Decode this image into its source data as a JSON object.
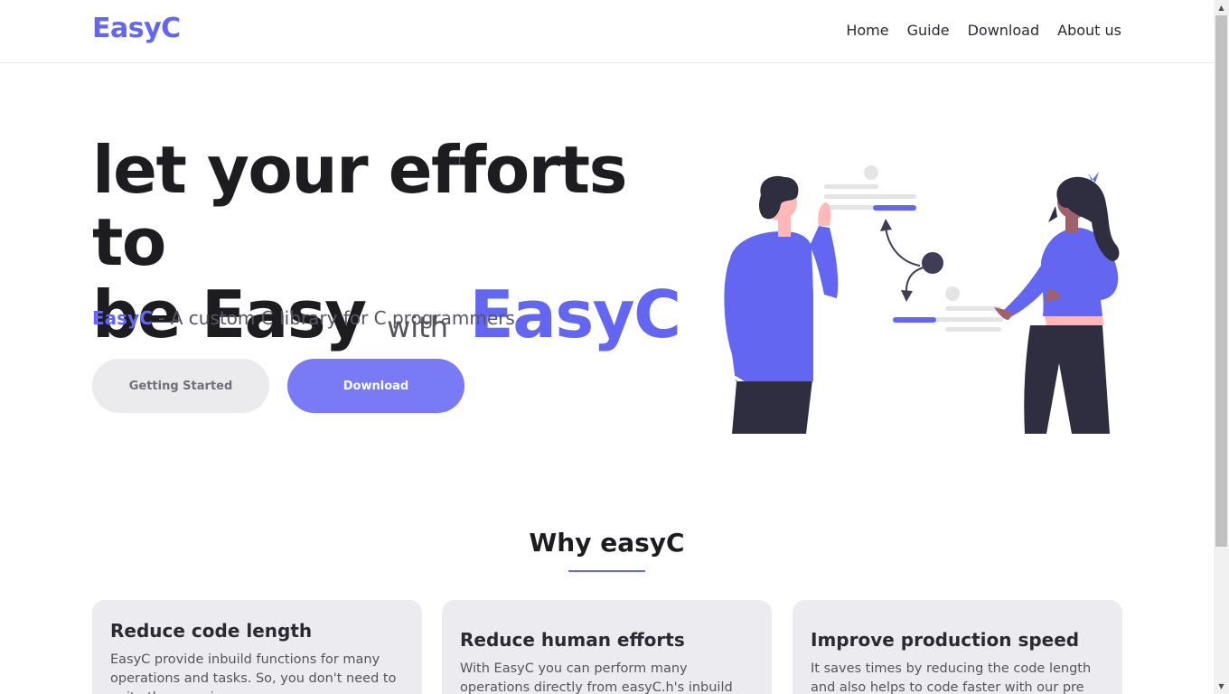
{
  "header": {
    "logo": "EasyC",
    "nav": [
      "Home",
      "Guide",
      "Download",
      "About us"
    ]
  },
  "hero": {
    "title_line1": "let your efforts to",
    "title_line2_a": "be Easy",
    "title_line2_with": "with",
    "title_line2_brand": "EasyC",
    "subtitle_brand": "EasyC",
    "subtitle_rest": " - A custom C library for C programmers",
    "btn_getting_started": "Getting Started",
    "btn_download": "Download"
  },
  "why": {
    "title": "Why easyC",
    "cards": [
      {
        "title": "Reduce code length",
        "text": "EasyC provide inbuild functions for many operations and tasks. So, you don't need to write them again"
      },
      {
        "title": "Reduce human efforts",
        "text": "With EasyC you can perform many operations directly from easyC.h's inbuild functions"
      },
      {
        "title": "Improve production speed",
        "text": "It saves times by reducing the code length and also helps to code faster with our pre built functions"
      }
    ]
  },
  "colors": {
    "accent": "#6366f1",
    "button_primary": "#787bf5",
    "button_secondary": "#ebebee",
    "card_bg": "#ececf0",
    "dark": "#2f2e41"
  },
  "icons": {
    "illustration": "two-people-presentation-illustration",
    "scroll_up": "triangle-up-icon",
    "scroll_down": "triangle-down-icon"
  }
}
